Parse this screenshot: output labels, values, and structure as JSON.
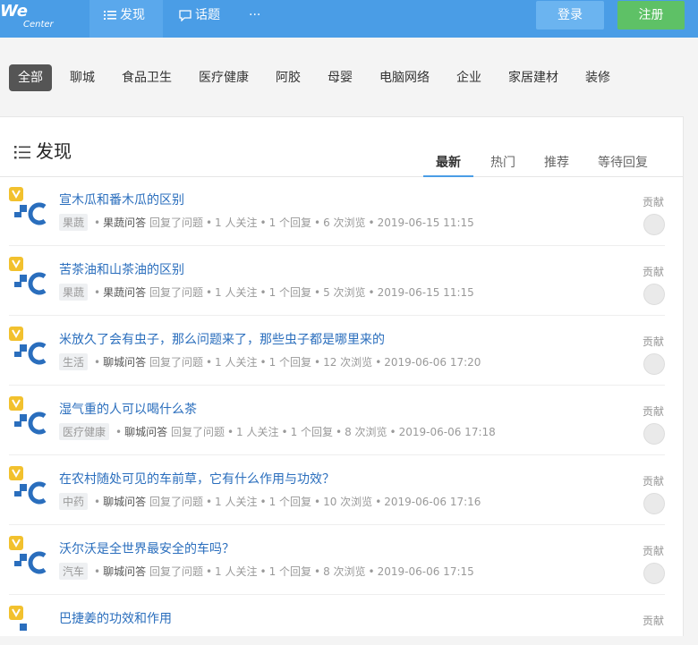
{
  "header": {
    "logo_we": "We",
    "logo_center": "Center",
    "nav": [
      {
        "label": "发现",
        "icon": "list-icon"
      },
      {
        "label": "话题",
        "icon": "chat-icon"
      },
      {
        "label": "···",
        "icon": "more-icon"
      }
    ],
    "login_label": "登录",
    "register_label": "注册"
  },
  "categories": [
    "全部",
    "聊城",
    "食品卫生",
    "医疗健康",
    "阿胶",
    "母婴",
    "电脑网络",
    "企业",
    "家居建材",
    "装修"
  ],
  "main": {
    "title": "发现",
    "tabs": [
      "最新",
      "热门",
      "推荐",
      "等待回复"
    ]
  },
  "items": [
    {
      "title": "宣木瓜和番木瓜的区别",
      "tag": "果蔬",
      "source": "果蔬问答",
      "action": "回复了问题",
      "follow": "1 人关注",
      "reply": "1 个回复",
      "views": "6 次浏览",
      "time": "2019-06-15 11:15",
      "contrib": "贡献"
    },
    {
      "title": "苦茶油和山茶油的区别",
      "tag": "果蔬",
      "source": "果蔬问答",
      "action": "回复了问题",
      "follow": "1 人关注",
      "reply": "1 个回复",
      "views": "5 次浏览",
      "time": "2019-06-15 11:15",
      "contrib": "贡献"
    },
    {
      "title": "米放久了会有虫子，那么问题来了，那些虫子都是哪里来的",
      "tag": "生活",
      "source": "聊城问答",
      "action": "回复了问题",
      "follow": "1 人关注",
      "reply": "1 个回复",
      "views": "12 次浏览",
      "time": "2019-06-06 17:20",
      "contrib": "贡献"
    },
    {
      "title": "湿气重的人可以喝什么茶",
      "tag": "医疗健康",
      "source": "聊城问答",
      "action": "回复了问题",
      "follow": "1 人关注",
      "reply": "1 个回复",
      "views": "8 次浏览",
      "time": "2019-06-06 17:18",
      "contrib": "贡献"
    },
    {
      "title": "在农村随处可见的车前草，它有什么作用与功效？",
      "tag": "中药",
      "source": "聊城问答",
      "action": "回复了问题",
      "follow": "1 人关注",
      "reply": "1 个回复",
      "views": "10 次浏览",
      "time": "2019-06-06 17:16",
      "contrib": "贡献"
    },
    {
      "title": "沃尔沃是全世界最安全的车吗？",
      "tag": "汽车",
      "source": "聊城问答",
      "action": "回复了问题",
      "follow": "1 人关注",
      "reply": "1 个回复",
      "views": "8 次浏览",
      "time": "2019-06-06 17:15",
      "contrib": "贡献"
    },
    {
      "title": "巴捷姜的功效和作用",
      "tag": "",
      "source": "",
      "action": "",
      "follow": "",
      "reply": "",
      "views": "",
      "time": "",
      "contrib": "贡献"
    }
  ],
  "colors": {
    "header_bg": "#4a9de6",
    "link": "#2a6ebd",
    "register": "#5ec166",
    "login": "#6bb4f0"
  }
}
